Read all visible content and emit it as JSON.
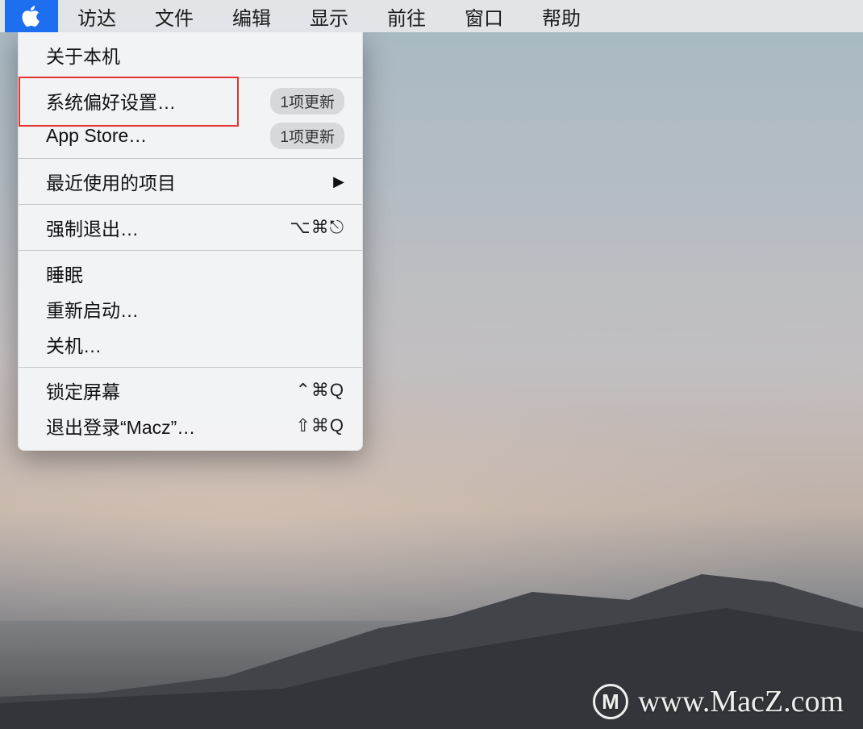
{
  "menubar": {
    "items": [
      "访达",
      "文件",
      "编辑",
      "显示",
      "前往",
      "窗口",
      "帮助"
    ]
  },
  "dropdown": {
    "about": "关于本机",
    "system_prefs": "系统偏好设置…",
    "system_prefs_badge": "1项更新",
    "app_store": "App Store…",
    "app_store_badge": "1项更新",
    "recent_items": "最近使用的项目",
    "force_quit": "强制退出…",
    "force_quit_shortcut": "⌥⌘⎋",
    "sleep": "睡眠",
    "restart": "重新启动…",
    "shutdown": "关机…",
    "lock_screen": "锁定屏幕",
    "lock_screen_shortcut": "⌃⌘Q",
    "logout": "退出登录“Macz”…",
    "logout_shortcut": "⇧⌘Q"
  },
  "watermark": {
    "logo_letter": "M",
    "text": "www.MacZ.com"
  }
}
